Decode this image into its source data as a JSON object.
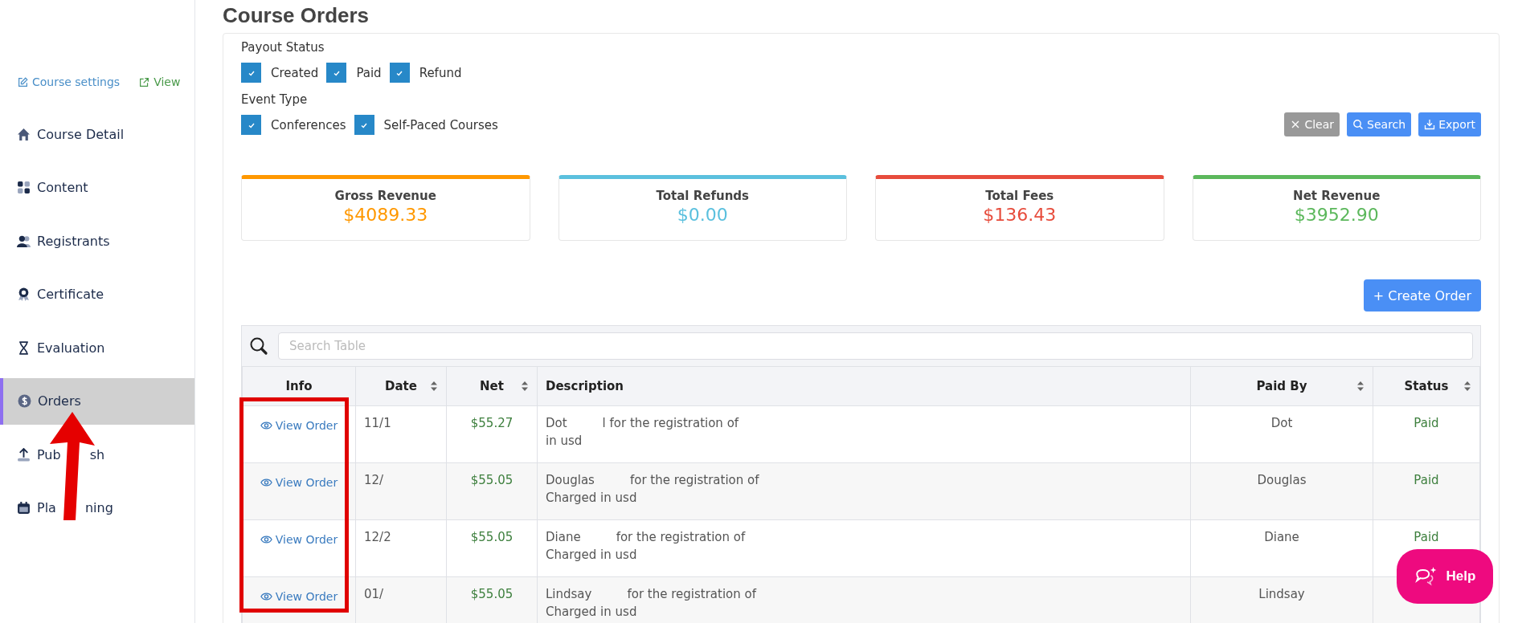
{
  "sidebar": {
    "links": [
      {
        "kind": "edit",
        "label": "Course settings"
      },
      {
        "kind": "external",
        "label": "View"
      }
    ],
    "items": [
      {
        "label": [
          "Course Detail"
        ],
        "selected": false
      },
      {
        "label": [
          "Content"
        ],
        "selected": false
      },
      {
        "label": [
          "Registrants"
        ],
        "selected": false
      },
      {
        "label": [
          "Certificate"
        ],
        "selected": false
      },
      {
        "label": [
          "Evaluation"
        ],
        "selected": false
      },
      {
        "label": [
          "Orders"
        ],
        "selected": true
      },
      {
        "label": [
          "Pub",
          "sh"
        ],
        "selected": false
      },
      {
        "label": [
          "Pla",
          "ning"
        ],
        "selected": false
      }
    ]
  },
  "page_title": "Course Orders",
  "filters": [
    {
      "label": "Payout Status",
      "options": [
        {
          "label": "Created",
          "checked": true
        },
        {
          "label": "Paid",
          "checked": true
        },
        {
          "label": "Refund",
          "checked": true
        }
      ]
    },
    {
      "label": "Event Type",
      "options": [
        {
          "label": "Conferences",
          "checked": true
        },
        {
          "label": "Self-Paced Courses",
          "checked": true
        }
      ]
    }
  ],
  "actions": [
    {
      "kind": "clear",
      "label": "Clear"
    },
    {
      "kind": "search",
      "label": "Search"
    },
    {
      "kind": "export",
      "label": "Export"
    }
  ],
  "stats": [
    {
      "label": "Gross Revenue",
      "value": "$4089.33",
      "color": "#ff9800"
    },
    {
      "label": "Total Refunds",
      "value": "$0.00",
      "color": "#5bc0de"
    },
    {
      "label": "Total Fees",
      "value": "$136.43",
      "color": "#e74c3c"
    },
    {
      "label": "Net Revenue",
      "value": "$3952.90",
      "color": "#5cb85c"
    }
  ],
  "create_button": "+ Create Order",
  "table": {
    "search_placeholder": "Search Table",
    "columns": [
      {
        "label": "Info",
        "sortable": false
      },
      {
        "label": "Date",
        "sortable": true
      },
      {
        "label": "Net",
        "sortable": true
      },
      {
        "label": "Description",
        "sortable": false
      },
      {
        "label": "Paid By",
        "sortable": true
      },
      {
        "label": "Status",
        "sortable": true
      }
    ],
    "rows": [
      {
        "info": "View Order",
        "date": "11/1",
        "net": "$55.27",
        "description": {
          "parts": [
            "Dot",
            "l for the registration of"
          ],
          "line2": "in usd"
        },
        "paid_by": "Dot",
        "status": "Paid"
      },
      {
        "info": "View Order",
        "date": "12/",
        "net": "$55.05",
        "description": {
          "parts": [
            "Douglas",
            "for the registration of"
          ],
          "line2": "Charged in usd"
        },
        "paid_by": "Douglas",
        "status": "Paid"
      },
      {
        "info": "View Order",
        "date": "12/2",
        "net": "$55.05",
        "description": {
          "parts": [
            "Diane",
            "for the registration of"
          ],
          "line2": "Charged in usd"
        },
        "paid_by": "Diane",
        "status": "Paid"
      },
      {
        "info": "View Order",
        "date": "01/",
        "net": "$55.05",
        "description": {
          "parts": [
            "Lindsay",
            "for the registration of"
          ],
          "line2": "Charged in usd"
        },
        "paid_by": "Lindsay"
      }
    ]
  },
  "help_button": "Help",
  "highlight_frame": true,
  "pointer_arrow": true
}
